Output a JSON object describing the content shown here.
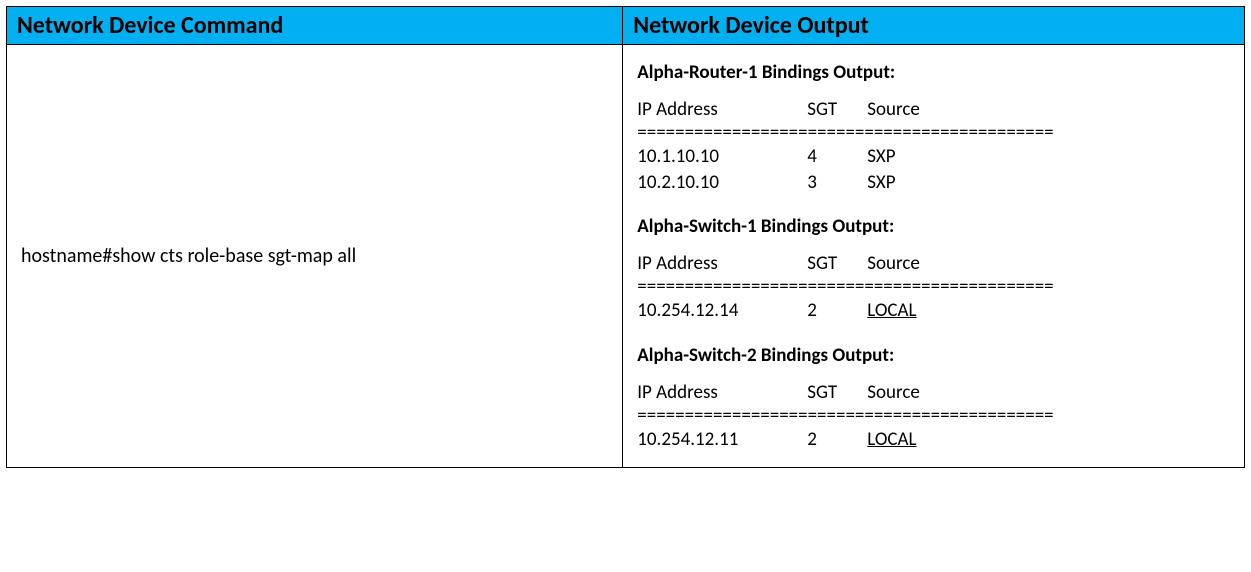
{
  "table": {
    "headers": {
      "col1": "Network Device Command",
      "col2": "Network Device Output"
    },
    "command": "hostname#show cts role-base sgt-map all",
    "output": {
      "columns": {
        "ip": "IP Address",
        "sgt": "SGT",
        "source": "Source"
      },
      "separator": "============================================",
      "sections": [
        {
          "title": "Alpha-Router-1 Bindings Output:",
          "rows": [
            {
              "ip": "10.1.10.10",
              "sgt": "4",
              "source": "SXP",
              "source_underlined": false
            },
            {
              "ip": "10.2.10.10",
              "sgt": "3",
              "source": "SXP",
              "source_underlined": false
            }
          ]
        },
        {
          "title": "Alpha-Switch-1 Bindings Output:",
          "rows": [
            {
              "ip": "10.254.12.14",
              "sgt": "2",
              "source": "LOCAL",
              "source_underlined": true
            }
          ]
        },
        {
          "title": "Alpha-Switch-2 Bindings Output:",
          "rows": [
            {
              "ip": "10.254.12.11",
              "sgt": "2",
              "source": "LOCAL",
              "source_underlined": true
            }
          ]
        }
      ]
    }
  }
}
